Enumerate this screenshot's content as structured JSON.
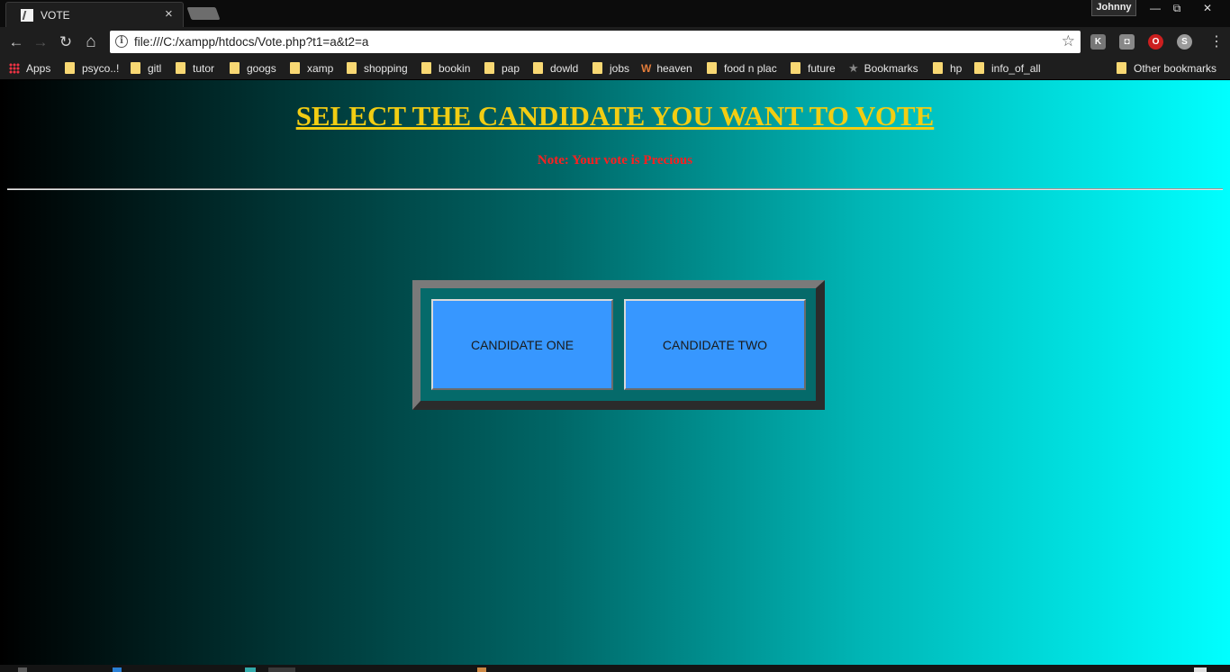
{
  "browser": {
    "tab_title": "VOTE",
    "tab_close": "×",
    "profile_name": "Johnny",
    "window_controls": {
      "minimize": "—",
      "restore": "⧉",
      "close": "✕"
    },
    "nav": {
      "back": "←",
      "forward": "→",
      "reload": "↻",
      "home": "⌂"
    },
    "url": "file:///C:/xampp/htdocs/Vote.php?t1=a&t2=a",
    "bookmarks": [
      "psyco..!",
      "gitl",
      "tutor",
      "googs",
      "xamp",
      "shopping",
      "bookin",
      "pap",
      "dowld",
      "jobs",
      "heaven",
      "food n plac",
      "future",
      "Bookmarks",
      "hp",
      "info_of_all"
    ],
    "apps_label": "Apps",
    "other_bookmarks": "Other bookmarks"
  },
  "page": {
    "heading": "SELECT THE CANDIDATE YOU WANT TO VOTE",
    "note": "Note: Your vote is Precious",
    "buttons": {
      "candidate_one": "CANDIDATE ONE",
      "candidate_two": "CANDIDATE TWO"
    }
  },
  "colors": {
    "heading": "#f2cd13",
    "note": "#ff1f1f",
    "button": "#3797ff",
    "gradient_start": "#000000",
    "gradient_end": "#00ffff"
  }
}
